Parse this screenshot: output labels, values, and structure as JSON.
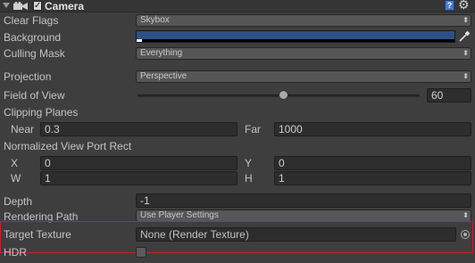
{
  "component": {
    "title": "Camera",
    "enabled": true,
    "help_icon": "help-icon",
    "settings_icon": "gear-icon"
  },
  "fields": {
    "clear_flags": {
      "label": "Clear Flags",
      "value": "Skybox"
    },
    "background": {
      "label": "Background",
      "color": "#2f4f84"
    },
    "culling_mask": {
      "label": "Culling Mask",
      "value": "Everything"
    },
    "projection": {
      "label": "Projection",
      "value": "Perspective"
    },
    "field_of_view": {
      "label": "Field of View",
      "value": "60",
      "slider_fraction": 0.52
    },
    "clipping_planes": {
      "label": "Clipping Planes",
      "near": {
        "label": "Near",
        "value": "0.3"
      },
      "far": {
        "label": "Far",
        "value": "1000"
      }
    },
    "viewport_rect": {
      "label": "Normalized View Port Rect",
      "x": {
        "label": "X",
        "value": "0"
      },
      "y": {
        "label": "Y",
        "value": "0"
      },
      "w": {
        "label": "W",
        "value": "1"
      },
      "h": {
        "label": "H",
        "value": "1"
      }
    },
    "depth": {
      "label": "Depth",
      "value": "-1"
    },
    "rendering_path": {
      "label": "Rendering Path",
      "value": "Use Player Settings"
    },
    "target_texture": {
      "label": "Target Texture",
      "value": "None (Render Texture)"
    },
    "hdr": {
      "label": "HDR",
      "checked": false
    }
  },
  "colors": {
    "panel_bg": "#3e3e3e",
    "highlight": "#c2222a",
    "background_color": "#2f4f84"
  }
}
